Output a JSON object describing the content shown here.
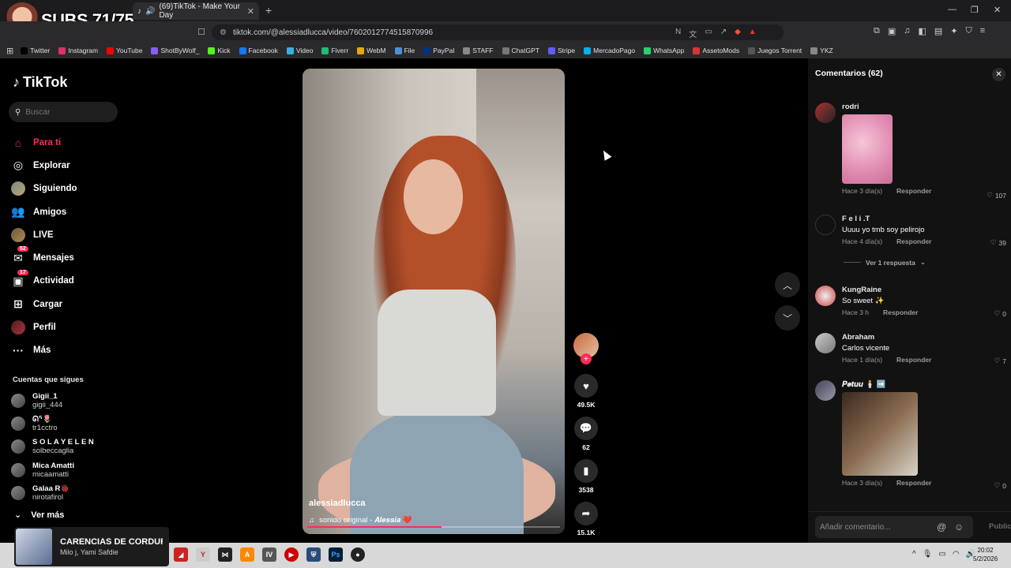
{
  "overlay": {
    "subs_text": "SUBS 71/75"
  },
  "browser": {
    "tab_title": "(69)TikTok - Make Your Day",
    "new_tab": "+",
    "url": "tiktok.com/@alessiadlucca/video/7602012774515870996",
    "window_controls": [
      "—",
      "❐",
      "✕"
    ],
    "bookmarks": [
      {
        "label": "Twitter",
        "color": "#000000"
      },
      {
        "label": "Instagram",
        "color": "#e1306c"
      },
      {
        "label": "YouTube",
        "color": "#ff0000"
      },
      {
        "label": "ShotByWolf_",
        "color": "#8a5cf6"
      },
      {
        "label": "Kick",
        "color": "#53fc18"
      },
      {
        "label": "Facebook",
        "color": "#1877f2"
      },
      {
        "label": "Video",
        "color": "#3ab0e2"
      },
      {
        "label": "Fiverr",
        "color": "#1dbf73"
      },
      {
        "label": "WebM",
        "color": "#e6a817"
      },
      {
        "label": "File",
        "color": "#4a90d9"
      },
      {
        "label": "PayPal",
        "color": "#003087"
      },
      {
        "label": "STAFF",
        "color": "#888888"
      },
      {
        "label": "ChatGPT",
        "color": "#777777"
      },
      {
        "label": "Stripe",
        "color": "#635bff"
      },
      {
        "label": "MercadoPago",
        "color": "#00b1ea"
      },
      {
        "label": "WhatsApp",
        "color": "#25d366"
      },
      {
        "label": "AssetoMods",
        "color": "#d33"
      },
      {
        "label": "Juegos Torrent",
        "color": "#555555"
      },
      {
        "label": "YKZ",
        "color": "#888888"
      }
    ]
  },
  "tiktok": {
    "logo": "TikTok",
    "search_placeholder": "Buscar",
    "nav": [
      {
        "label": "Para ti",
        "icon": "home-icon",
        "active": true
      },
      {
        "label": "Explorar",
        "icon": "compass-icon"
      },
      {
        "label": "Siguiendo",
        "icon": "following-avatar-icon"
      },
      {
        "label": "Amigos",
        "icon": "friends-icon"
      },
      {
        "label": "LIVE",
        "icon": "live-icon"
      },
      {
        "label": "Mensajes",
        "icon": "messages-icon",
        "badge": "52"
      },
      {
        "label": "Actividad",
        "icon": "activity-icon",
        "badge": "17"
      },
      {
        "label": "Cargar",
        "icon": "upload-icon"
      },
      {
        "label": "Perfil",
        "icon": "profile-icon"
      },
      {
        "label": "Más",
        "icon": "more-icon"
      }
    ],
    "following_title": "Cuentas que sigues",
    "following": [
      {
        "name": "Gigii_1",
        "handle": "gigii_444"
      },
      {
        "name": "ᘏᕐ🌷",
        "handle": "tr1cctro"
      },
      {
        "name": "S O L A Y E L E N",
        "handle": "solbeccaglia"
      },
      {
        "name": "Mica Amatti",
        "handle": "micaamatti"
      },
      {
        "name": "Galaa R🐞",
        "handle": "nirotafirol"
      }
    ],
    "see_more": "Ver más"
  },
  "video": {
    "username": "alessiadlucca",
    "sound": "sonido original - 𝑨𝒍𝒆𝒔𝒔𝒊𝒂 ❤️",
    "progress": 0.53,
    "likes": "49.5K",
    "comments": "62",
    "saves": "3538",
    "shares": "15.1K"
  },
  "comments_panel": {
    "title": "Comentarios (62)",
    "close": "✕",
    "reply_label": "Responder",
    "items": [
      {
        "name": "rodri",
        "text": "",
        "time": "Hace 3 día(s)",
        "likes": "107",
        "sticker": "st1"
      },
      {
        "name": "F e l i .T",
        "text": "Uuuu yo tmb soy pelirojo",
        "time": "Hace 4 día(s)",
        "likes": "39"
      },
      {
        "name": "KungRaine",
        "text": "So sweet ✨",
        "time": "Hace 3 h",
        "likes": "0"
      },
      {
        "name": "Abraham",
        "text": "Carlos vicente",
        "time": "Hace 1 día(s)",
        "likes": "7"
      },
      {
        "name": "𝑷𝒆𝒕𝒖𝒖 🕯️ ➡️",
        "text": "",
        "time": "Hace 3 día(s)",
        "likes": "0",
        "sticker": "st2"
      }
    ],
    "replies_toggle": "Ver 1 respuesta",
    "input_placeholder": "Añadir comentario...",
    "publish": "Publicar"
  },
  "taskbar": {
    "media_title": "CARENCIAS DE CORDURA",
    "media_artist": "Milo j, Yami Safdie",
    "clock_time": "20:02",
    "clock_date": "5/2/2026"
  }
}
